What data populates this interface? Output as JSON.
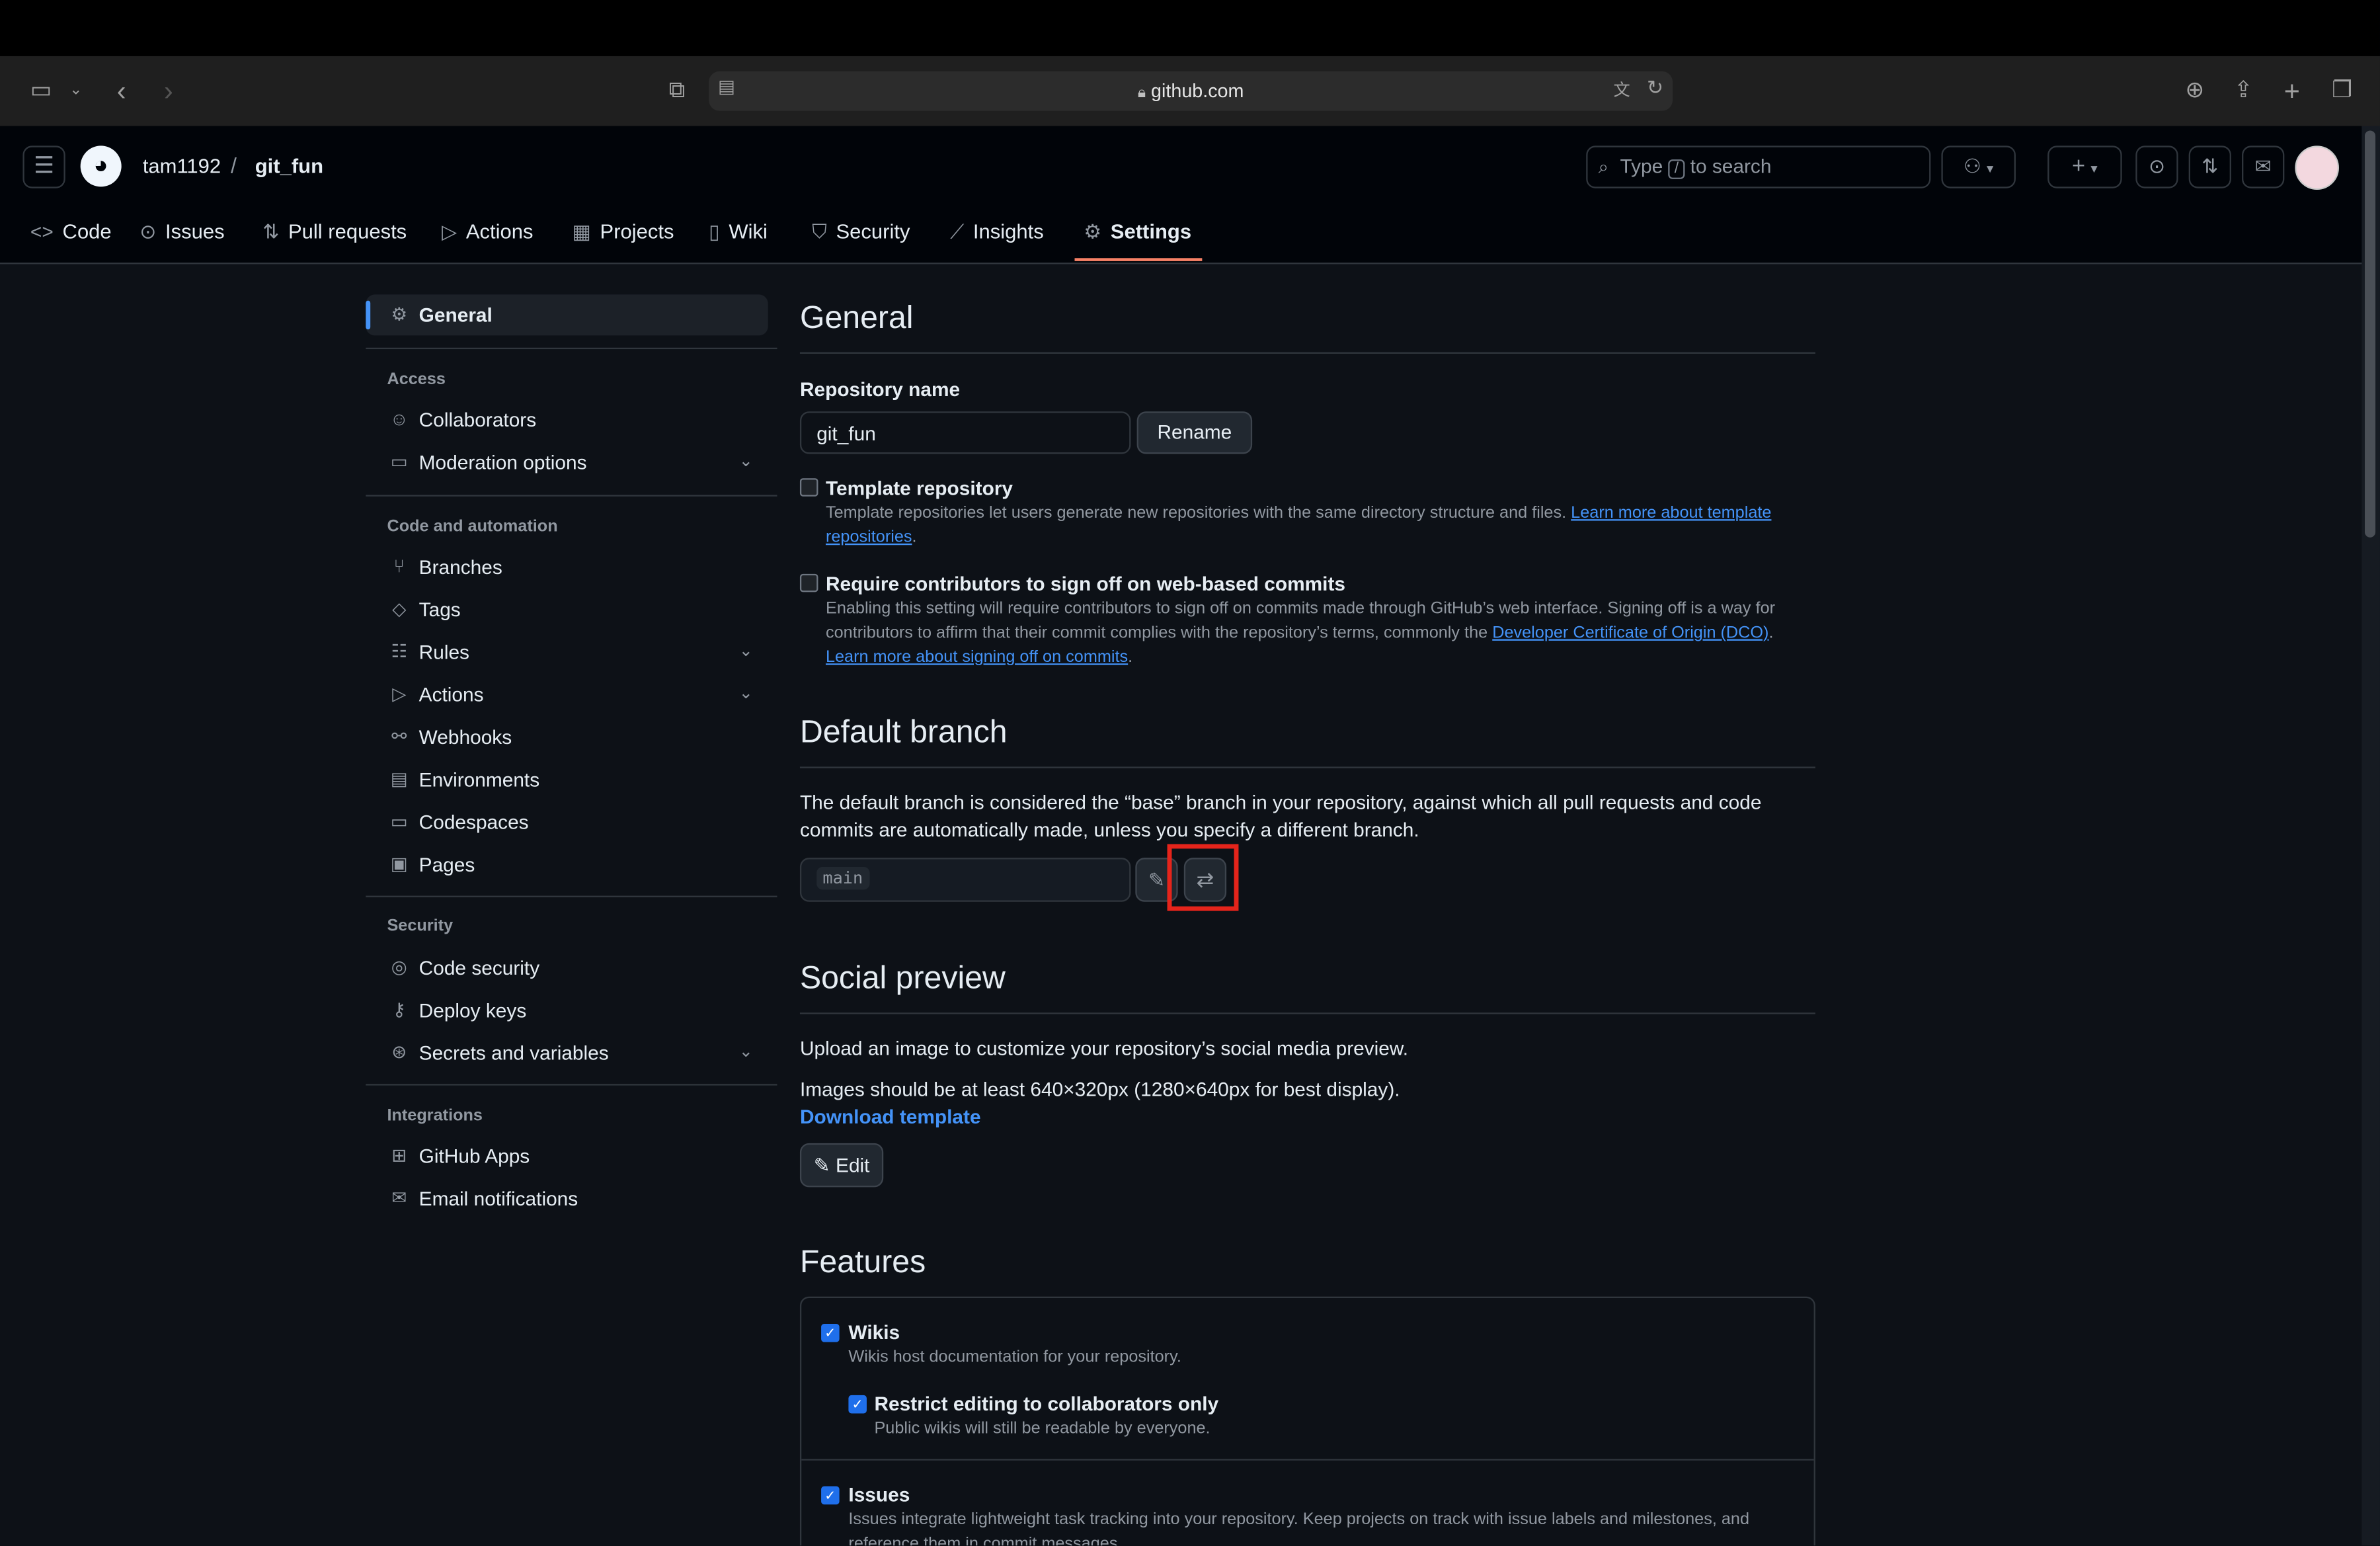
{
  "browser": {
    "url": "github.com",
    "icons": [
      "sidebar-icon",
      "chevron-down-icon",
      "back-icon",
      "forward-icon",
      "tab-overview-icon",
      "reader-icon",
      "lock-icon",
      "translate-icon",
      "reload-icon",
      "download-icon",
      "share-icon",
      "new-tab-icon",
      "tabs-icon"
    ]
  },
  "header": {
    "owner": "tam1192",
    "separator": "/",
    "repo": "git_fun",
    "search_prefix": "Type",
    "search_key": "/",
    "search_suffix": "to search"
  },
  "tabs": [
    {
      "label": "Code",
      "icon": "code-icon"
    },
    {
      "label": "Issues",
      "icon": "issue-icon"
    },
    {
      "label": "Pull requests",
      "icon": "pull-request-icon"
    },
    {
      "label": "Actions",
      "icon": "play-icon"
    },
    {
      "label": "Projects",
      "icon": "table-icon"
    },
    {
      "label": "Wiki",
      "icon": "book-icon"
    },
    {
      "label": "Security",
      "icon": "shield-icon"
    },
    {
      "label": "Insights",
      "icon": "graph-icon"
    },
    {
      "label": "Settings",
      "icon": "gear-icon",
      "active": true
    }
  ],
  "sidebar": {
    "general": "General",
    "access_heading": "Access",
    "access": [
      "Collaborators",
      "Moderation options"
    ],
    "code_heading": "Code and automation",
    "code": [
      "Branches",
      "Tags",
      "Rules",
      "Actions",
      "Webhooks",
      "Environments",
      "Codespaces",
      "Pages"
    ],
    "security_heading": "Security",
    "security": [
      "Code security",
      "Deploy keys",
      "Secrets and variables"
    ],
    "integrations_heading": "Integrations",
    "integrations": [
      "GitHub Apps",
      "Email notifications"
    ]
  },
  "general": {
    "title": "General",
    "repo_name_label": "Repository name",
    "repo_name_value": "git_fun",
    "rename": "Rename",
    "template_label": "Template repository",
    "template_desc": "Template repositories let users generate new repositories with the same directory structure and files.",
    "template_link_a": "Learn more about template",
    "template_link_b": "repositories",
    "signoff_label": "Require contributors to sign off on web-based commits",
    "signoff_desc_1": "Enabling this setting will require contributors to sign off on commits made through GitHub’s web interface. Signing off is a way for",
    "signoff_desc_2": "contributors to affirm that their commit complies with the repository’s terms, commonly the",
    "signoff_link_dco": "Developer Certificate of Origin (DCO)",
    "signoff_link_learn": "Learn more about signing off on commits"
  },
  "default_branch": {
    "title": "Default branch",
    "desc_1": "The default branch is considered the “base” branch in your repository, against which all pull requests and code",
    "desc_2": "commits are automatically made, unless you specify a different branch.",
    "branch": "main"
  },
  "social": {
    "title": "Social preview",
    "desc": "Upload an image to customize your repository’s social media preview.",
    "size": "Images should be at least 640×320px (1280×640px for best display).",
    "download": "Download template",
    "edit": "Edit"
  },
  "features": {
    "title": "Features",
    "wikis_label": "Wikis",
    "wikis_desc": "Wikis host documentation for your repository.",
    "restrict_label": "Restrict editing to collaborators only",
    "restrict_desc": "Public wikis will still be readable by everyone.",
    "issues_label": "Issues",
    "issues_desc_1": "Issues integrate lightweight task tracking into your repository. Keep projects on track with issue labels and milestones, and",
    "issues_desc_2": "reference them in commit messages."
  },
  "colors": {
    "accent": "#f78166",
    "link": "#4493f8",
    "highlight": "#e5241b",
    "checkbox": "#1f6feb"
  }
}
